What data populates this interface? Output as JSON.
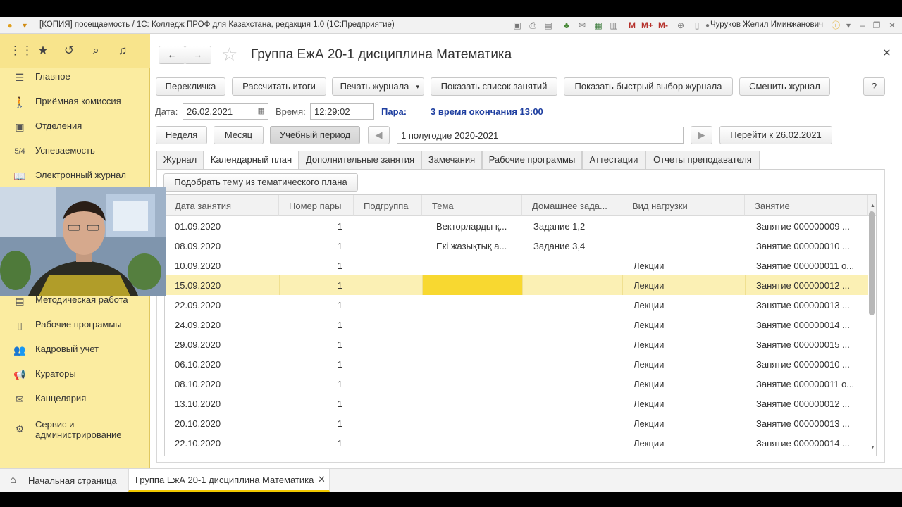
{
  "window": {
    "title": "[КОПИЯ] посещаемость / 1С: Колледж ПРОФ для Казахстана, редакция 1.0 (1С:Предприятие)",
    "memory_buttons": [
      "M",
      "M+",
      "M-"
    ],
    "user": "Чуруков Желил Иминжанович"
  },
  "sidebar": {
    "items": [
      {
        "icon": "menu-lines-icon",
        "label": "Главное"
      },
      {
        "icon": "person-walking-icon",
        "label": "Приёмная комиссия"
      },
      {
        "icon": "building-icon",
        "label": "Отделения"
      },
      {
        "icon": "grade-icon",
        "label": "Успеваемость",
        "glyph": "5/4"
      },
      {
        "icon": "book-icon",
        "label": "Электронный журнал"
      },
      {
        "icon": "books-icon",
        "label": "Методическая работа"
      },
      {
        "icon": "document-icon",
        "label": "Рабочие программы"
      },
      {
        "icon": "people-icon",
        "label": "Кадровый учет"
      },
      {
        "icon": "megaphone-icon",
        "label": "Кураторы"
      },
      {
        "icon": "envelope-icon",
        "label": "Канцелярия"
      },
      {
        "icon": "tools-icon",
        "label": "Сервис и администрирование"
      }
    ]
  },
  "form": {
    "title": "Группа ЕжА 20-1 дисциплина Математика",
    "help": "?",
    "toolbar": [
      "Перекличка",
      "Рассчитать итоги",
      "Печать журнала",
      "Показать список занятий",
      "Показать быстрый выбор журнала",
      "Сменить журнал"
    ],
    "date_label": "Дата:",
    "date_value": "26.02.2021",
    "time_label": "Время:",
    "time_value": "12:29:02",
    "pair_label": "Пара:",
    "pair_value": "3 время окончания 13:00",
    "period_buttons": [
      "Неделя",
      "Месяц",
      "Учебный период"
    ],
    "period_value": "1 полугодие 2020-2021",
    "goto": "Перейти к 26.02.2021",
    "tabs": [
      "Журнал",
      "Календарный план",
      "Дополнительные занятия",
      "Замечания",
      "Рабочие программы",
      "Аттестации",
      "Отчеты преподавателя"
    ],
    "pick_theme": "Подобрать тему из тематического плана"
  },
  "table": {
    "columns": [
      "Дата занятия",
      "Номер пары",
      "Подгруппа",
      "Тема",
      "Домашнее зада...",
      "Вид нагрузки",
      "Занятие"
    ],
    "rows": [
      [
        "01.09.2020",
        "1",
        "",
        "Векторларды қ...",
        "Задание 1,2",
        "",
        "Занятие 000000009 ..."
      ],
      [
        "08.09.2020",
        "1",
        "",
        "Екі жазықтық а...",
        "Задание 3,4",
        "",
        "Занятие 000000010 ..."
      ],
      [
        "10.09.2020",
        "1",
        "",
        "",
        "",
        "Лекции",
        "Занятие 000000011 о..."
      ],
      [
        "15.09.2020",
        "1",
        "",
        "",
        "",
        "Лекции",
        "Занятие 000000012 ..."
      ],
      [
        "22.09.2020",
        "1",
        "",
        "",
        "",
        "Лекции",
        "Занятие 000000013 ..."
      ],
      [
        "24.09.2020",
        "1",
        "",
        "",
        "",
        "Лекции",
        "Занятие 000000014 ..."
      ],
      [
        "29.09.2020",
        "1",
        "",
        "",
        "",
        "Лекции",
        "Занятие 000000015 ..."
      ],
      [
        "06.10.2020",
        "1",
        "",
        "",
        "",
        "Лекции",
        "Занятие 000000010 ..."
      ],
      [
        "08.10.2020",
        "1",
        "",
        "",
        "",
        "Лекции",
        "Занятие 000000011 о..."
      ],
      [
        "13.10.2020",
        "1",
        "",
        "",
        "",
        "Лекции",
        "Занятие 000000012 ..."
      ],
      [
        "20.10.2020",
        "1",
        "",
        "",
        "",
        "Лекции",
        "Занятие 000000013 ..."
      ],
      [
        "22.10.2020",
        "1",
        "",
        "",
        "",
        "Лекции",
        "Занятие 000000014 ..."
      ]
    ],
    "selected_row": 3
  },
  "taskbar": {
    "home": "Начальная страница",
    "open_tab": "Группа ЕжА 20-1 дисциплина Математика"
  },
  "colors": {
    "sidebar": "#fbeca0",
    "selected_row": "#fbf0b4",
    "selected_cell": "#f8d830",
    "pair_blue": "#1f3fa0"
  }
}
